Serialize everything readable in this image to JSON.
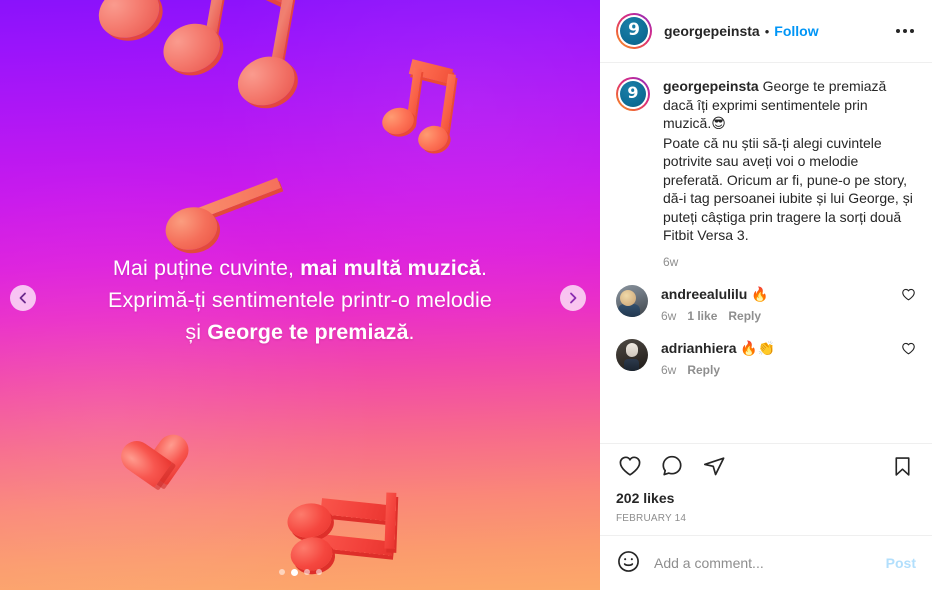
{
  "header": {
    "avatar_glyph": "9",
    "username": "georgepeinsta",
    "separator": "•",
    "follow_label": "Follow",
    "more_icon": "ellipsis-icon",
    "follow_color": "#0095f6"
  },
  "media": {
    "headline_line1_plain": "Mai puține cuvinte, ",
    "headline_line1_bold": "mai multă muzică",
    "headline_line1_end": ".",
    "headline_line2": "Exprimă-ți sentimentele printr-o melodie",
    "headline_line3_plain": "și ",
    "headline_line3_bold": "George te premiază",
    "headline_line3_end": ".",
    "prev_icon": "chevron-left-icon",
    "next_icon": "chevron-right-icon",
    "carousel_total": 4,
    "carousel_active_index": 2,
    "gradient_top": "#8a12fb",
    "gradient_mid": "#ea2ec8",
    "gradient_bottom": "#fca86a",
    "note_color": "#f4786c"
  },
  "caption": {
    "username": "georgepeinsta",
    "paragraph1": "George te premiază dacă îți exprimi sentimentele prin muzică.",
    "emoji1": "😎",
    "paragraph2": "Poate că nu știi să-ți alegi cuvintele potrivite sau aveți voi o melodie preferată. Oricum ar fi, pune-o pe story, dă-i tag persoanei iubite și lui George, și puteți câștiga prin tragere la sorți două Fitbit Versa 3.",
    "age": "6w"
  },
  "comments": [
    {
      "username": "andreealulilu",
      "text": "🔥",
      "age": "6w",
      "likes": "1 like",
      "reply": "Reply",
      "heart_icon": "heart-outline-icon"
    },
    {
      "username": "adrianhiera",
      "text": "🔥👏",
      "age": "6w",
      "likes": "",
      "reply": "Reply",
      "heart_icon": "heart-outline-icon"
    }
  ],
  "actions": {
    "like_icon": "heart-outline-icon",
    "comment_icon": "speech-bubble-icon",
    "share_icon": "paper-plane-icon",
    "save_icon": "bookmark-outline-icon",
    "likes_count": "202 likes",
    "date": "FEBRUARY 14"
  },
  "add_comment": {
    "emoji_icon": "smiley-face-icon",
    "value": "",
    "placeholder": "Add a comment...",
    "post_label": "Post",
    "post_color": "#b2dffc"
  }
}
